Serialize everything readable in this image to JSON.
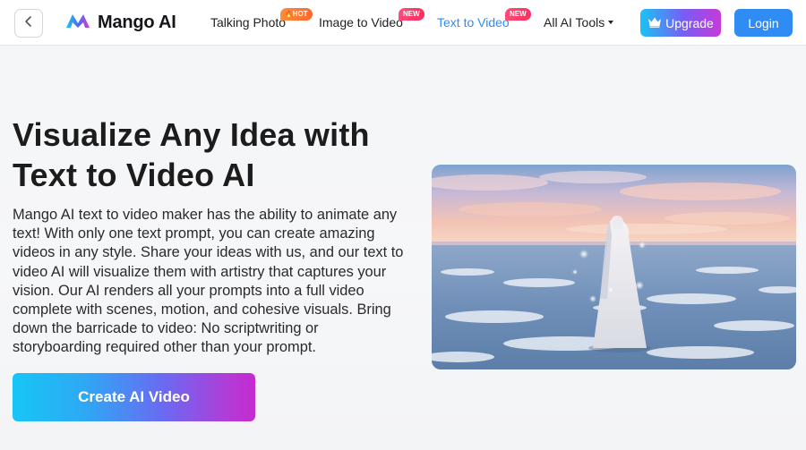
{
  "header": {
    "logo_text": "Mango AI",
    "nav": [
      {
        "label": "Talking Photo",
        "badge": "HOT"
      },
      {
        "label": "Image to Video",
        "badge": "NEW"
      },
      {
        "label": "Text to Video",
        "badge": "NEW",
        "active": true
      },
      {
        "label": "All AI Tools"
      }
    ],
    "upgrade_label": "Upgrade",
    "login_label": "Login"
  },
  "hero": {
    "title_line1": "Visualize Any Idea with",
    "title_line2": "Text to Video AI",
    "description": "Mango AI text to video maker has the ability to animate any text! With only one text prompt, you can create amazing videos in any style. Share your ideas with us, and our text to video AI will visualize them with artistry that captures your vision. Our AI renders all your prompts into a full video complete with scenes, motion, and cohesive visuals. Bring down the barricade to video: No scriptwriting or storyboarding required other than your prompt.",
    "cta_label": "Create AI Video"
  },
  "colors": {
    "accent_blue": "#2f8cf5",
    "gradient_start": "#17c6f6",
    "gradient_end": "#c62ad0",
    "hot_badge": "#ff7a33",
    "new_badge": "#ff3b6b"
  },
  "icons": {
    "back": "chevron-left-icon",
    "logo": "mango-logo-icon",
    "upgrade": "crown-icon",
    "dropdown": "caret-down-icon"
  }
}
